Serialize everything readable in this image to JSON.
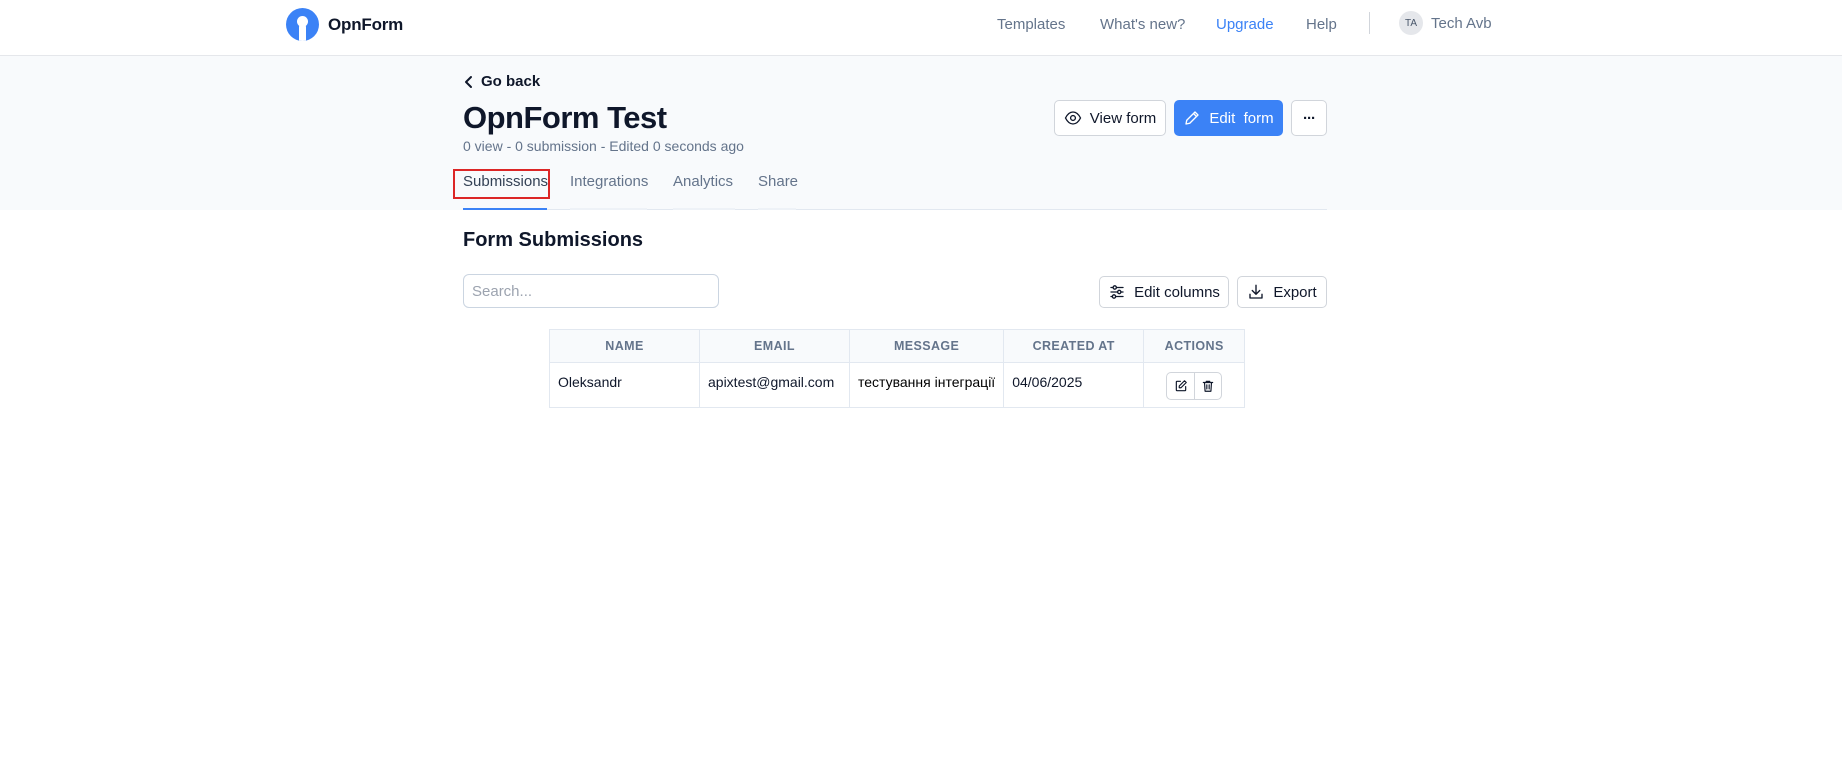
{
  "nav": {
    "brand": "OpnForm",
    "links": [
      "Templates",
      "What's new?",
      "Upgrade",
      "Help"
    ],
    "user_initials": "TA",
    "user_name": "Tech Avb"
  },
  "header": {
    "go_back": "Go back",
    "title": "OpnForm Test",
    "meta": "0 view - 0 submission - Edited 0 seconds ago",
    "view_form": "View form",
    "edit_form": "Edit  form",
    "more_label": "···"
  },
  "tabs": [
    "Submissions",
    "Integrations",
    "Analytics",
    "Share"
  ],
  "active_tab": "Submissions",
  "content": {
    "section_title": "Form Submissions",
    "search_placeholder": "Search...",
    "edit_columns": "Edit columns",
    "export": "Export"
  },
  "table": {
    "headers": [
      "NAME",
      "EMAIL",
      "MESSAGE",
      "CREATED AT",
      "ACTIONS"
    ],
    "rows": [
      [
        "Oleksandr",
        "apixtest@gmail.com",
        "тестування інтеграції",
        "04/06/2025"
      ]
    ]
  },
  "colors": {
    "accent": "#3b82f6",
    "highlight": "#dc2626"
  },
  "icons": [
    "logo-icon",
    "chevron-left-icon",
    "eye-icon",
    "pencil-icon",
    "ellipsis-icon",
    "sliders-icon",
    "download-icon",
    "edit-icon",
    "trash-icon"
  ]
}
